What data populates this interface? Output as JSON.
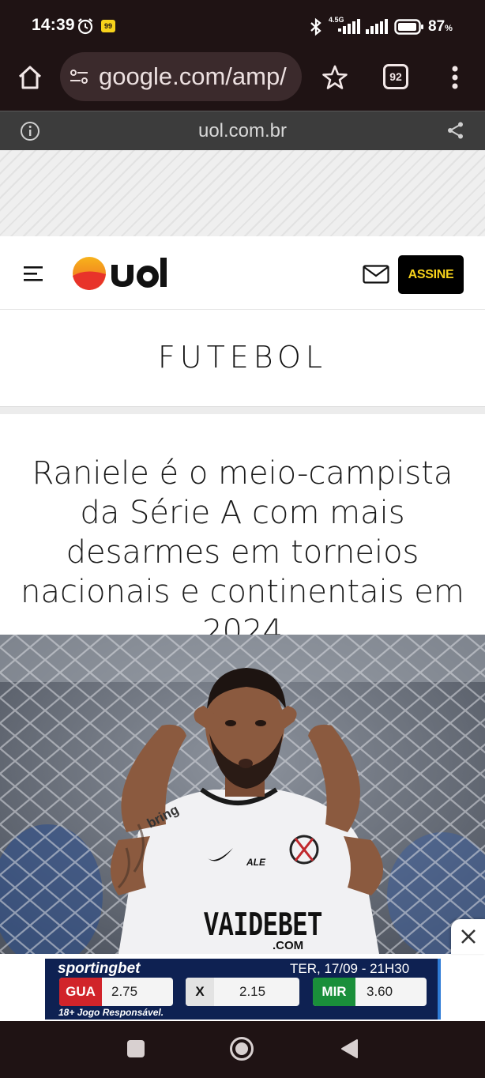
{
  "status_bar": {
    "time": "14:39",
    "app_badge": "99",
    "network": "4.5G",
    "battery": "87",
    "battery_unit": "%"
  },
  "browser": {
    "url": "google.com/amp/",
    "tab_count": "92",
    "domain": "uol.com.br"
  },
  "site_header": {
    "assine_label": "ASSINE"
  },
  "article": {
    "section": "FUTEBOL",
    "headline": "Raniele é o meio-campista da Série A com mais desarmes em torneios nacionais e continentais em 2024",
    "photo_text": {
      "sponsor_brand": "bring",
      "sponsor_ale": "ALE",
      "shirt_sponsor": "VAIDEBET",
      "shirt_sponsor_sub": ".COM"
    }
  },
  "bet_ad": {
    "brand_part1": "sporting",
    "brand_part2": "bet",
    "date": "TER, 17/09 - 21H30",
    "odds": [
      {
        "team": "GUA",
        "value": "2.75",
        "color": "#d1242a"
      },
      {
        "team": "X",
        "value": "2.15",
        "color": "#e6e6e6"
      },
      {
        "team": "MIR",
        "value": "3.60",
        "color": "#1a8f3a"
      }
    ],
    "disclaimer": "18+ Jogo Responsável."
  },
  "colors": {
    "system_bar": "#1f1314",
    "uol_yellow": "#f7d21b",
    "uol_orange": "#ee3e2a"
  }
}
